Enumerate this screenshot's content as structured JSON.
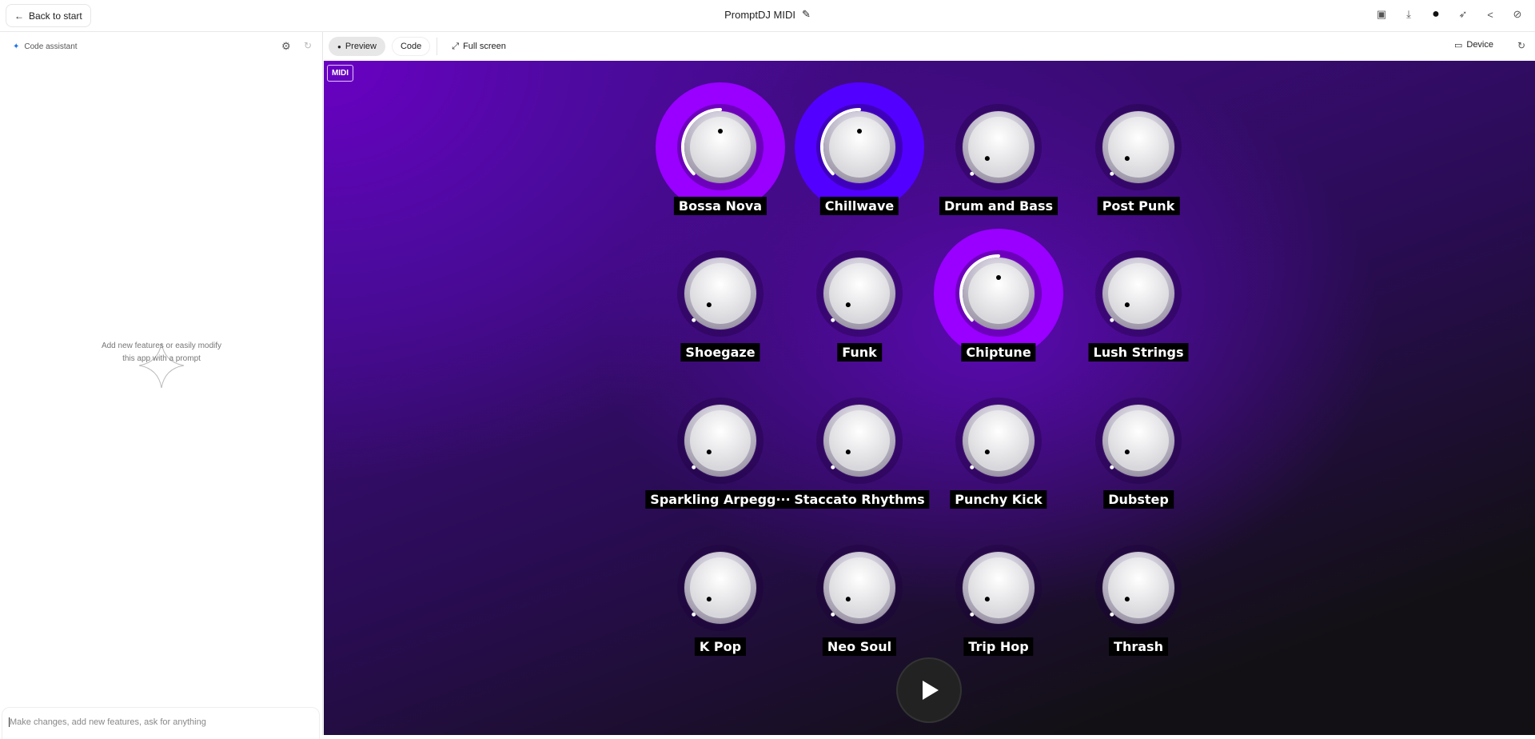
{
  "topbar": {
    "back_label": "Back to start",
    "title": "PromptDJ MIDI",
    "icons": [
      "save-icon",
      "download-icon",
      "github-icon",
      "rocket-icon",
      "share-icon",
      "hide-icon"
    ]
  },
  "left_panel": {
    "title": "Code assistant",
    "empty_line1": "Add new features or easily modify",
    "empty_line2": "this app with a prompt",
    "chat_placeholder": "Make changes, add new features, ask for anything"
  },
  "toolbar": {
    "preview": "Preview",
    "code": "Code",
    "fullscreen": "Full screen",
    "device": "Device"
  },
  "app": {
    "midi_label": "MIDI",
    "knobs": [
      {
        "label": "Bossa Nova",
        "value": 0.5,
        "color": "#9900ff"
      },
      {
        "label": "Chillwave",
        "value": 0.5,
        "color": "#5200ff"
      },
      {
        "label": "Drum and Bass",
        "value": 0,
        "color": "#ff25f6"
      },
      {
        "label": "Post Punk",
        "value": 0,
        "color": "#2af6de"
      },
      {
        "label": "Shoegaze",
        "value": 0,
        "color": "#ffdd28"
      },
      {
        "label": "Funk",
        "value": 0,
        "color": "#2af6de"
      },
      {
        "label": "Chiptune",
        "value": 0.5,
        "color": "#9900ff"
      },
      {
        "label": "Lush Strings",
        "value": 0,
        "color": "#3dffab"
      },
      {
        "label": "Sparkling Arpegg···",
        "value": 0,
        "color": "#d8ff3e"
      },
      {
        "label": "Staccato Rhythms",
        "value": 0,
        "color": "#d9b2ff"
      },
      {
        "label": "Punchy Kick",
        "value": 0,
        "color": "#3dffab"
      },
      {
        "label": "Dubstep",
        "value": 0,
        "color": "#ffdd28"
      },
      {
        "label": "K Pop",
        "value": 0,
        "color": "#ff25f6"
      },
      {
        "label": "Neo Soul",
        "value": 0,
        "color": "#d8ff3e"
      },
      {
        "label": "Trip Hop",
        "value": 0,
        "color": "#5200ff"
      },
      {
        "label": "Thrash",
        "value": 0,
        "color": "#d9b2ff"
      }
    ]
  }
}
